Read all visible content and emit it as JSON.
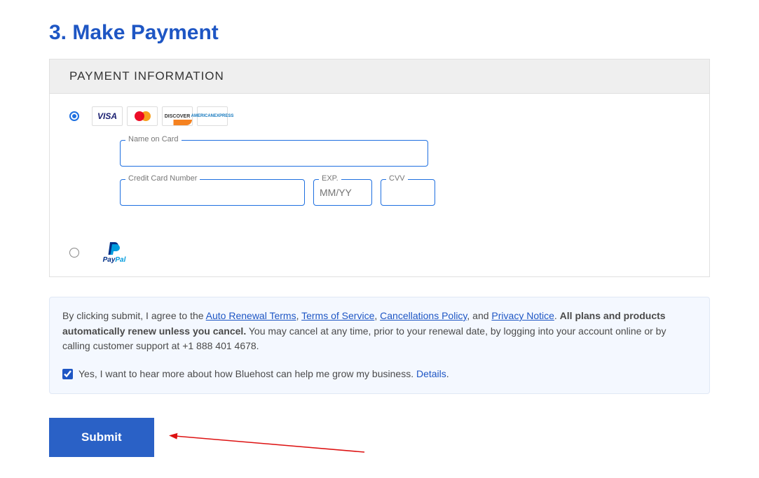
{
  "heading": "3. Make Payment",
  "panel_title": "PAYMENT INFORMATION",
  "cards": {
    "visa": "VISA",
    "discover": "DISCOVER",
    "amex_line1": "AMERICAN",
    "amex_line2": "EXPRESS"
  },
  "fields": {
    "name_label": "Name on Card",
    "name_value": "",
    "cc_label": "Credit Card Number",
    "cc_value": "",
    "exp_label": "EXP.",
    "exp_placeholder": "MM/YY",
    "exp_value": "",
    "cvv_label": "CVV",
    "cvv_value": ""
  },
  "paypal": {
    "pay": "Pay",
    "pal": "Pal"
  },
  "terms": {
    "prefix": "By clicking submit, I agree to the ",
    "link_auto": "Auto Renewal Terms",
    "sep1": ", ",
    "link_tos": "Terms of Service",
    "sep2": ", ",
    "link_cancel": "Cancellations Policy",
    "sep3": ", and ",
    "link_privacy": "Privacy Notice",
    "after_links": ". ",
    "bold": "All plans and products automatically renew unless you cancel.",
    "tail": " You may cancel at any time, prior to your renewal date, by logging into your account online or by calling customer support at +1 888 401 4678."
  },
  "optin": {
    "text": "Yes, I want to hear more about how Bluehost can help me grow my business. ",
    "details": "Details",
    "dot": "."
  },
  "submit": "Submit"
}
